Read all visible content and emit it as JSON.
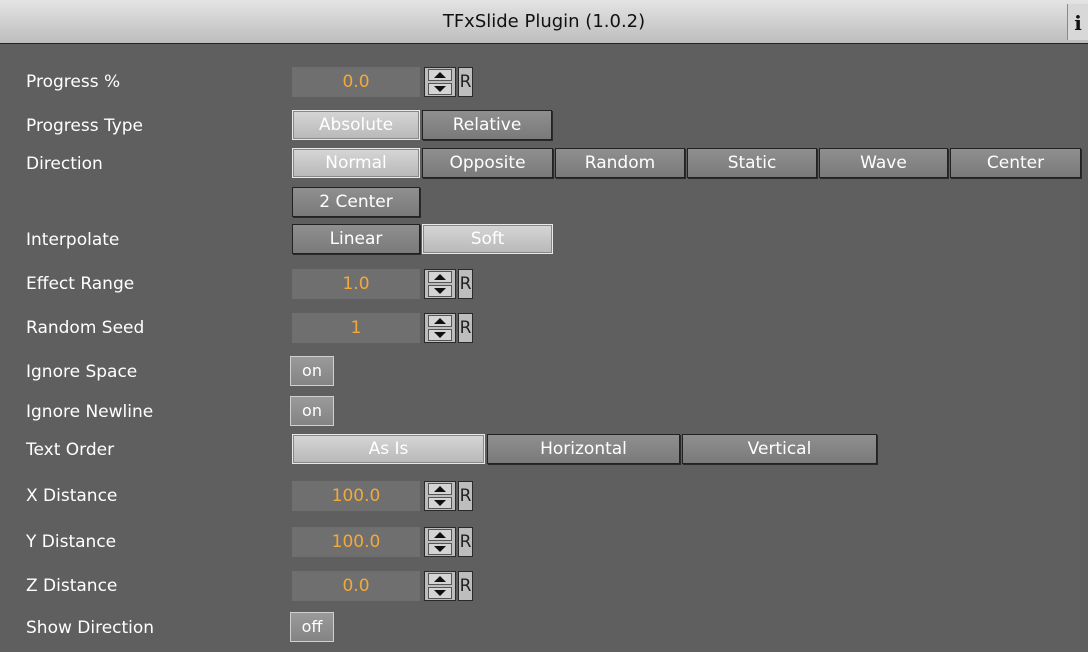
{
  "window": {
    "title": "TFxSlide Plugin (1.0.2)",
    "info_label": "i"
  },
  "rows": {
    "progress": {
      "label": "Progress %",
      "value": "0.0",
      "reset": "R"
    },
    "progress_type": {
      "label": "Progress Type",
      "options": [
        "Absolute",
        "Relative"
      ],
      "selected": "Absolute"
    },
    "direction": {
      "label": "Direction",
      "options": [
        "Normal",
        "Opposite",
        "Random",
        "Static",
        "Wave",
        "Center",
        "2 Center"
      ],
      "selected": "Normal"
    },
    "interpolate": {
      "label": "Interpolate",
      "options": [
        "Linear",
        "Soft"
      ],
      "selected": "Soft"
    },
    "effect_range": {
      "label": "Effect Range",
      "value": "1.0",
      "reset": "R"
    },
    "random_seed": {
      "label": "Random Seed",
      "value": "1",
      "reset": "R"
    },
    "ignore_space": {
      "label": "Ignore Space",
      "value": "on"
    },
    "ignore_newline": {
      "label": "Ignore Newline",
      "value": "on"
    },
    "text_order": {
      "label": "Text Order",
      "options": [
        "As Is",
        "Horizontal",
        "Vertical"
      ],
      "selected": "As Is"
    },
    "x_distance": {
      "label": "X Distance",
      "value": "100.0",
      "reset": "R"
    },
    "y_distance": {
      "label": "Y Distance",
      "value": "100.0",
      "reset": "R"
    },
    "z_distance": {
      "label": "Z Distance",
      "value": "0.0",
      "reset": "R"
    },
    "show_direction": {
      "label": "Show Direction",
      "value": "off"
    }
  },
  "colors": {
    "background": "#5f5f5f",
    "value_text": "#f3a93a",
    "title_bar": "#d0d0d0"
  }
}
